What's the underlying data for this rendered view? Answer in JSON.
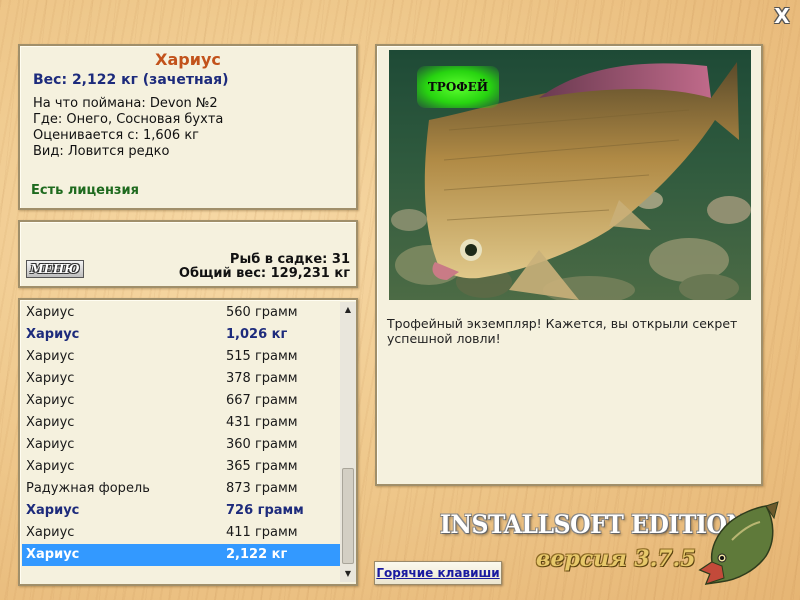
{
  "window": {
    "close_label": "X"
  },
  "fish_info": {
    "title": "Хариус",
    "weight_line": "Вес: 2,122 кг (зачетная)",
    "bait_line": "На что поймана: Devon №2",
    "place_line": "Где: Онего, Сосновая бухта",
    "rating_line": "Оценивается с: 1,606 кг",
    "rarity_line": "Вид: Ловится редко",
    "license": "Есть лицензия"
  },
  "summary": {
    "menu_label": "МЕНЮ",
    "count_line": "Рыб в садке: 31",
    "total_line": "Общий вес: 129,231 кг"
  },
  "catch_list": [
    {
      "name": "Хариус",
      "weight": "560 грамм",
      "style": "normal"
    },
    {
      "name": "Хариус",
      "weight": "1,026 кг",
      "style": "bold"
    },
    {
      "name": "Хариус",
      "weight": "515 грамм",
      "style": "normal"
    },
    {
      "name": "Хариус",
      "weight": "378 грамм",
      "style": "normal"
    },
    {
      "name": "Хариус",
      "weight": "667 грамм",
      "style": "normal"
    },
    {
      "name": "Хариус",
      "weight": "431 грамм",
      "style": "normal"
    },
    {
      "name": "Хариус",
      "weight": "360 грамм",
      "style": "normal"
    },
    {
      "name": "Хариус",
      "weight": "365 грамм",
      "style": "normal"
    },
    {
      "name": "Радужная форель",
      "weight": "873 грамм",
      "style": "normal"
    },
    {
      "name": "Хариус",
      "weight": "726 грамм",
      "style": "bold"
    },
    {
      "name": "Хариус",
      "weight": "411 грамм",
      "style": "normal"
    },
    {
      "name": "Хариус",
      "weight": "2,122 кг",
      "style": "selected"
    }
  ],
  "picture": {
    "badge": "ТРОФЕЙ",
    "caption": "Трофейный экземпляр! Кажется, вы открыли секрет успешной ловли!"
  },
  "brand": {
    "title": "INSTALLSOFT EDITION",
    "version": "версия 3.7.5"
  },
  "hotkeys_label": "Горячие клавиши",
  "icons": {
    "close": "close-icon",
    "scroll_up": "scroll-up-arrow-icon",
    "scroll_down": "scroll-down-arrow-icon",
    "logo": "pike-fish-icon"
  }
}
